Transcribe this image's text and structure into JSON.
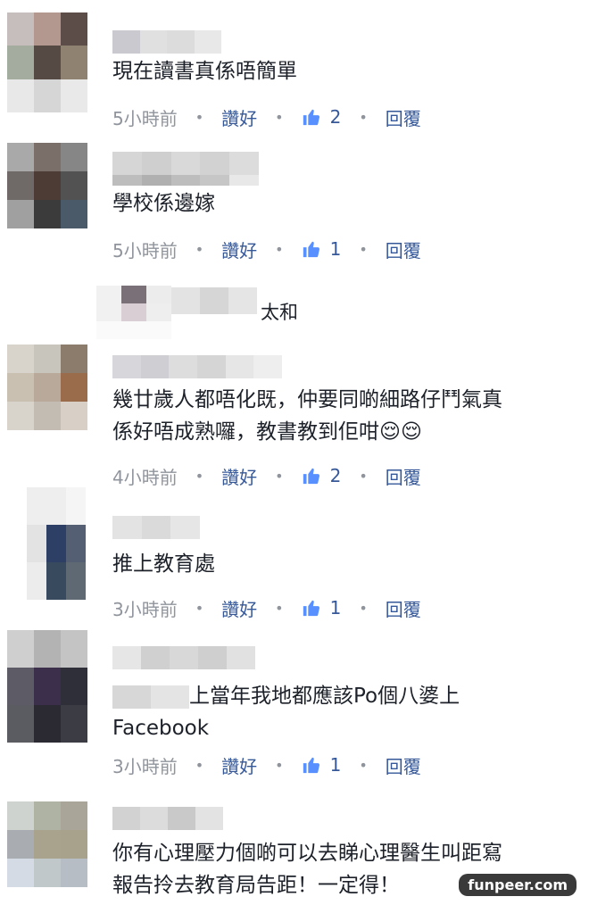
{
  "comments": [
    {
      "text": "現在讀書真係唔簡單",
      "time": "5小時前",
      "like_label": "讚好",
      "likes": "2",
      "reply_label": "回覆",
      "avatar_colors": [
        "#c6bdbd",
        "#b39890",
        "#5d4d49",
        "#a4ab9f",
        "#564b44",
        "#8f8271",
        "#e8e8e8",
        "#d6d6d6",
        "#e9e9e9"
      ]
    },
    {
      "text": "學校係邊嫁",
      "time": "5小時前",
      "like_label": "讚好",
      "likes": "1",
      "reply_label": "回覆",
      "avatar_colors": [
        "#a9a9a9",
        "#7b6f69",
        "#868686",
        "#6f6a67",
        "#4d3b35",
        "#525252",
        "#a0a0a0",
        "#3b3b3b",
        "#4a5a69"
      ]
    },
    {
      "text": "太和",
      "reply_row": true,
      "avatar_colors": [
        "#f1f1f1",
        "#7a7077",
        "#ececec",
        "#f1f1f1",
        "#d9ced3",
        "#eeeeee",
        "#fafafa",
        "#fafafa",
        "#fafafa"
      ]
    },
    {
      "text": "幾廿歲人都唔化既，仲要同啲細路仔鬥氣真\n係好唔成熟囉，教書教到佢咁😌😌",
      "time": "4小時前",
      "like_label": "讚好",
      "likes": "2",
      "reply_label": "回覆",
      "avatar_colors": [
        "#d8d4cc",
        "#c8c5bd",
        "#8c7c6c",
        "#c9c0b2",
        "#b9a99a",
        "#9a6c4c",
        "#d9d4cb",
        "#c3bcb2",
        "#d8d0c6"
      ]
    },
    {
      "text": "推上教育處",
      "time": "3小時前",
      "like_label": "讚好",
      "likes": "1",
      "reply_label": "回覆",
      "avatar_colors": [
        "#eeeeee",
        "#eeeeee",
        "#f5f5f5",
        "#e3e3e3",
        "#2e3f66",
        "#545f73",
        "#ececec",
        "#384a5e",
        "#5e6974"
      ]
    },
    {
      "text": "上當年我地都應該Po個八婆上\nFacebook",
      "time": "3小時前",
      "like_label": "讚好",
      "likes": "1",
      "reply_label": "回覆",
      "avatar_colors": [
        "#cfcfcf",
        "#b3b3b3",
        "#c4c4c4",
        "#5d5c66",
        "#3b2f4c",
        "#2f2f39",
        "#5b5b62",
        "#2b2a33",
        "#3c3c44"
      ]
    },
    {
      "text": "你有心理壓力個啲可以去睇心理醫生叫距寫\n報告拎去教育局告距！一定得！",
      "avatar_colors": [
        "#cfd3d0",
        "#aeb3a4",
        "#a9a599",
        "#a9adb2",
        "#a9a38e",
        "#a8a18c",
        "#d4dbe4",
        "#c0c8c9",
        "#b7bdc4"
      ]
    }
  ],
  "watermark": "funpeer.com"
}
